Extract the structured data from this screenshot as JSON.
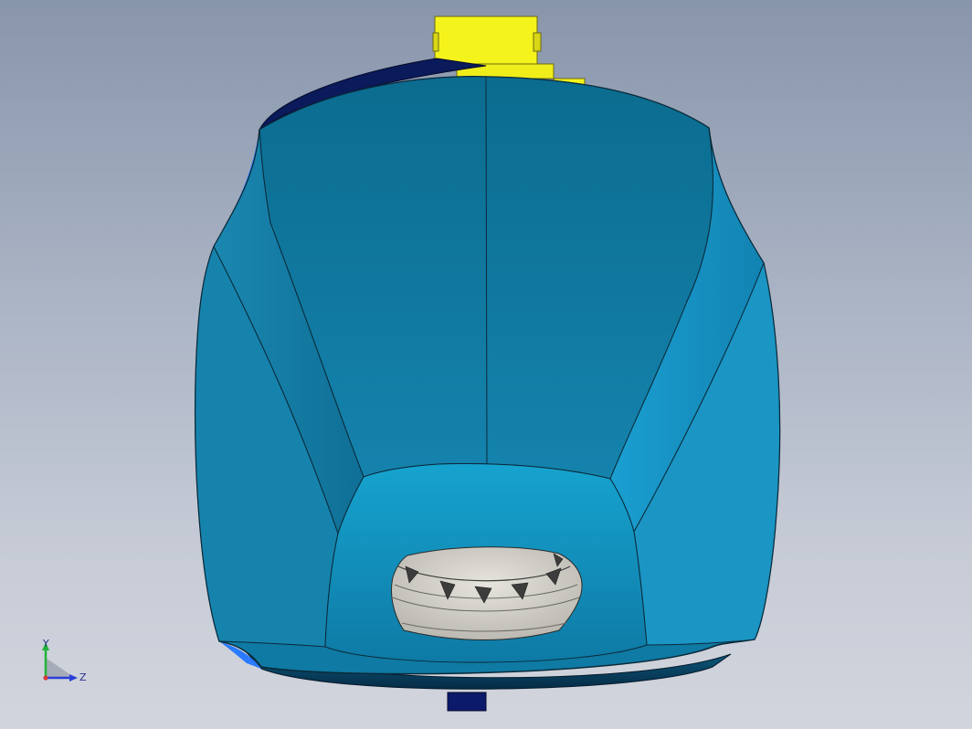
{
  "viewport": {
    "background_top": "#8895ab",
    "background_bottom": "#d2d5dd"
  },
  "model": {
    "body_color": "#0f7aa3",
    "face_light_color": "#1d9dcc",
    "face_dark_color": "#0c6a90",
    "edge_color": "#0a2a3a",
    "rim_color": "#0b1a5a",
    "highlight_color": "#2a7bff",
    "cap_color": "#f5f31c",
    "opening_fill_color": "#d8d6cf",
    "teeth_color": "#3c3c3c",
    "foot_color": "#0b1a6a"
  },
  "triad": {
    "x_label": "Y",
    "z_label": "Z",
    "y_color": "#22b33a",
    "z_color": "#2b3fd6",
    "x_color": "#d63a3a"
  }
}
